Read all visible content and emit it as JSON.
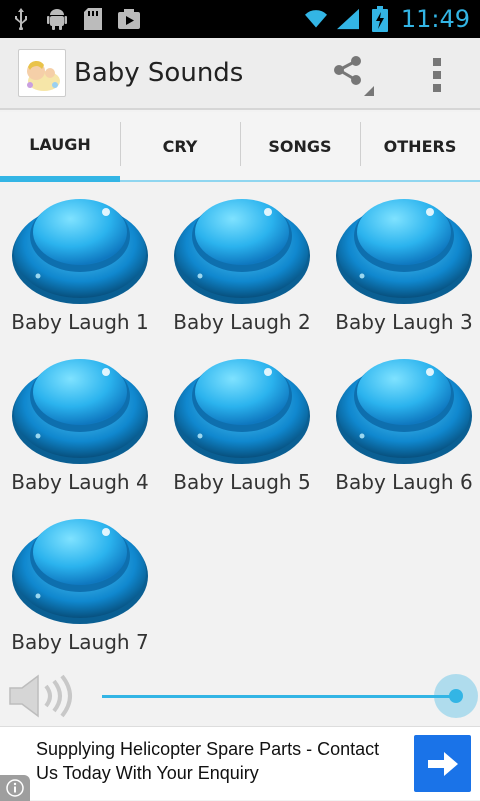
{
  "status_bar": {
    "time": "11:49",
    "icons": [
      "usb-icon",
      "android-icon",
      "sd-card-icon",
      "play-store-icon",
      "wifi-icon",
      "signal-icon",
      "battery-charging-icon"
    ],
    "accent_color": "#33b5e5"
  },
  "action_bar": {
    "title": "Baby Sounds",
    "actions": [
      "share-icon",
      "overflow-menu-icon"
    ]
  },
  "tabs": [
    {
      "label": "LAUGH",
      "active": true
    },
    {
      "label": "CRY",
      "active": false
    },
    {
      "label": "SONGS",
      "active": false
    },
    {
      "label": "OTHERS",
      "active": false
    }
  ],
  "sounds": [
    {
      "label": "Baby Laugh 1"
    },
    {
      "label": "Baby Laugh 2"
    },
    {
      "label": "Baby Laugh 3"
    },
    {
      "label": "Baby Laugh 4"
    },
    {
      "label": "Baby Laugh 5"
    },
    {
      "label": "Baby Laugh 6"
    },
    {
      "label": "Baby Laugh 7"
    }
  ],
  "volume": {
    "icon": "speaker-icon",
    "level": 1.0
  },
  "ad": {
    "text": "Supplying Helicopter Spare Parts - Contact Us Today With Your Enquiry",
    "button_icon": "arrow-right-icon",
    "info_icon": "info-icon"
  },
  "colors": {
    "accent": "#33b5e5",
    "button_blue": "#1e9fe0",
    "ad_button": "#1a73e8"
  }
}
